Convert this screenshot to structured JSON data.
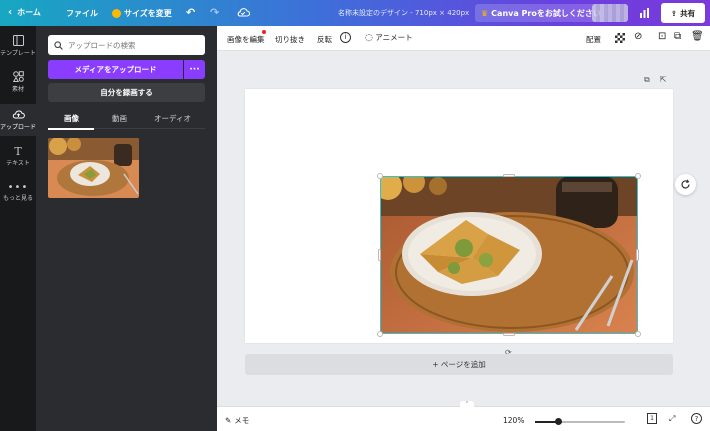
{
  "topbar": {
    "home_label": "ホーム",
    "file_label": "ファイル",
    "resize_label": "サイズを変更",
    "doc_title": "名称未設定のデザイン - 710px × 420px",
    "try_pro_label": "Canva Proをお試しください",
    "share_label": "共有",
    "gradient_start": "#17a7c2",
    "gradient_end": "#7b3ad9"
  },
  "rail": {
    "items": [
      {
        "label": "テンプレート",
        "icon": "template-icon"
      },
      {
        "label": "素材",
        "icon": "elements-icon"
      },
      {
        "label": "アップロード",
        "icon": "upload-cloud-icon",
        "active": true
      },
      {
        "label": "テキスト",
        "icon": "text-icon"
      },
      {
        "label": "もっと見る",
        "icon": "more-dots-icon"
      }
    ]
  },
  "panel": {
    "search_placeholder": "アップロードの検索",
    "upload_button": "メディアをアップロード",
    "more_button": "···",
    "record_button": "自分を録画する",
    "tabs": [
      {
        "label": "画像",
        "active": true
      },
      {
        "label": "動画",
        "active": false
      },
      {
        "label": "オーディオ",
        "active": false
      }
    ],
    "accent_color": "#8b3dff"
  },
  "toolbar": {
    "edit_image": "画像を編集",
    "crop": "切り抜き",
    "flip": "反転",
    "animate": "アニメート",
    "arrange": "配置"
  },
  "canvas": {
    "add_page": "+ ページを追加",
    "selection_color": "#2ec4d4"
  },
  "footer": {
    "memo": "メモ",
    "zoom": "120%",
    "zoom_fraction": 0.25,
    "page_count": "1",
    "help": "?"
  }
}
